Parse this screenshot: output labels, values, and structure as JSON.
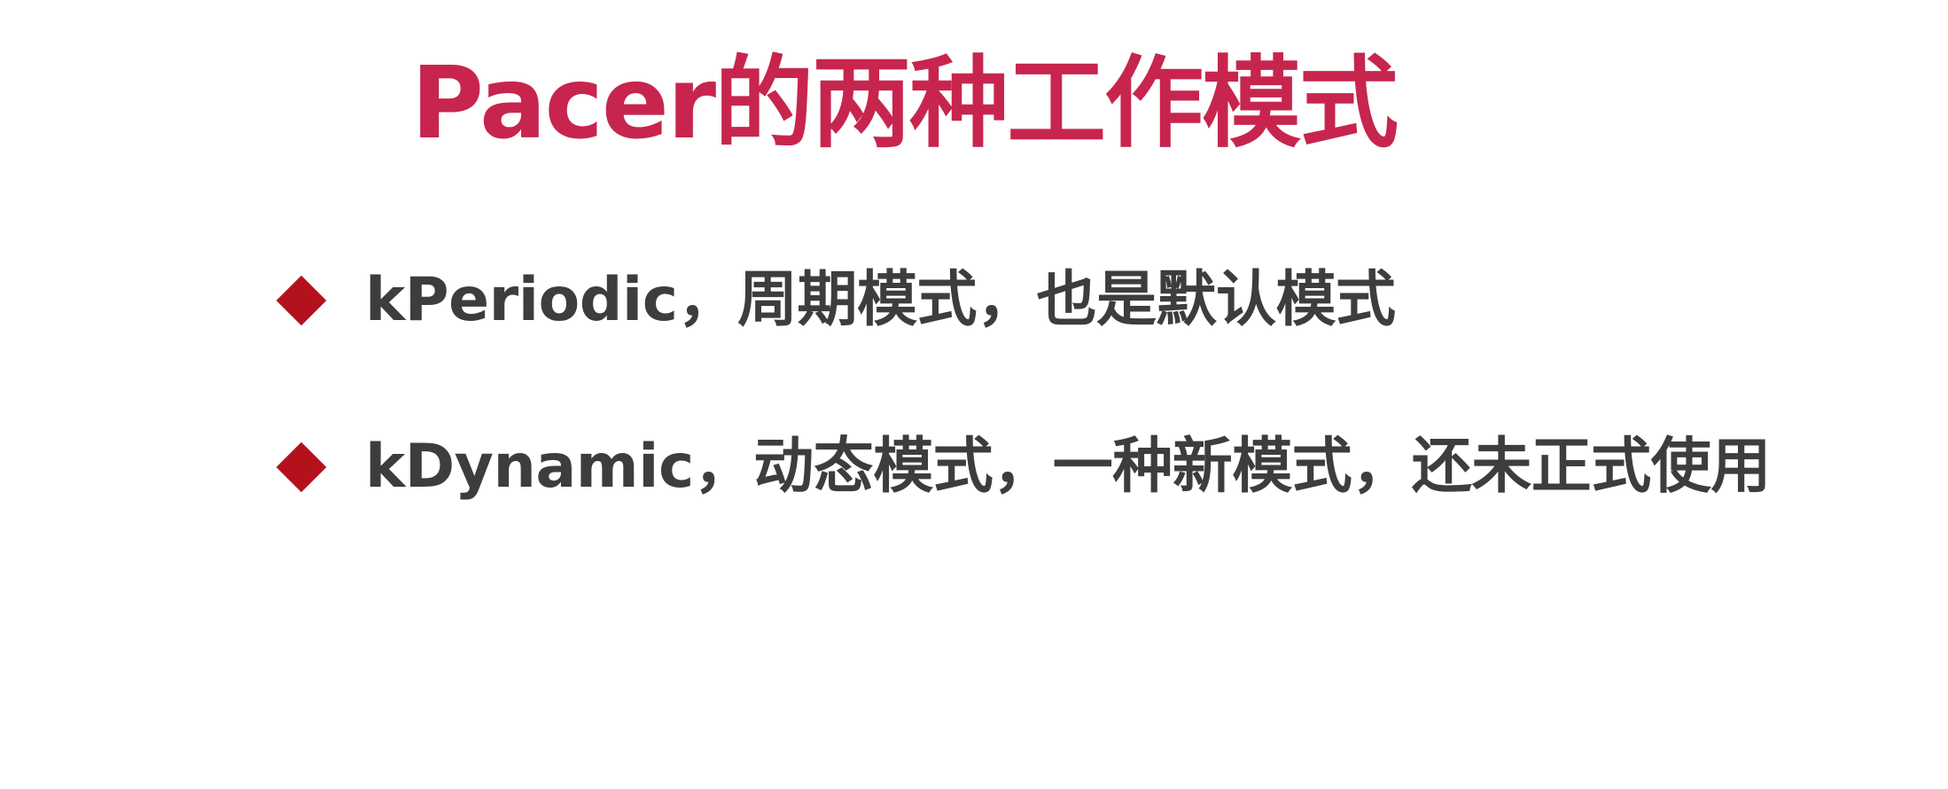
{
  "slide": {
    "title": "Pacer的两种工作模式",
    "bullets": [
      {
        "icon": "diamond-bullet-icon",
        "text": "kPeriodic，周期模式，也是默认模式"
      },
      {
        "icon": "diamond-bullet-icon",
        "text": "kDynamic，动态模式，一种新模式，还未正式使用"
      }
    ]
  },
  "colors": {
    "title": "#c7254e",
    "bullet_marker": "#b3121c",
    "body_text": "#3d3d3d",
    "background": "#ffffff"
  }
}
